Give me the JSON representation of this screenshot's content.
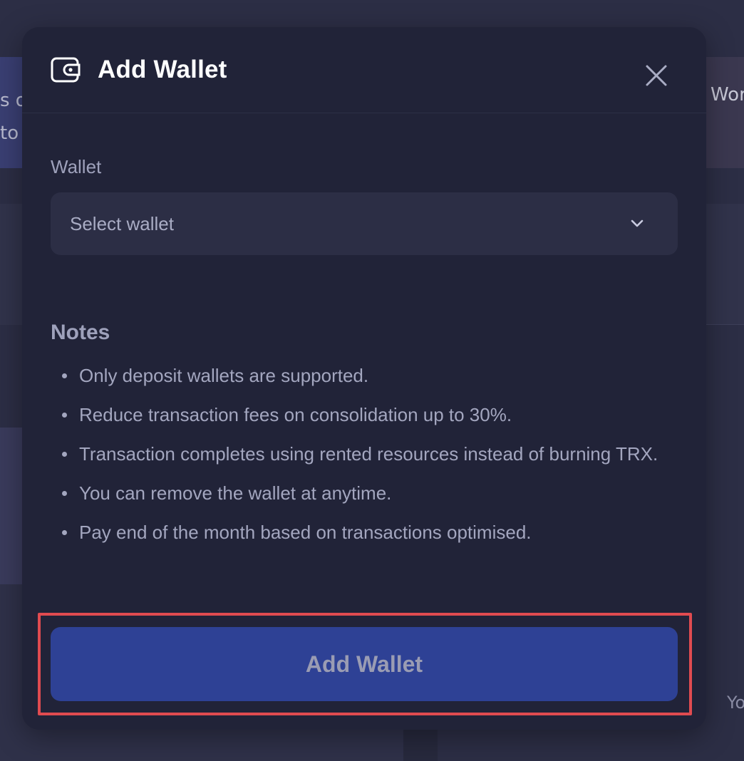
{
  "background": {
    "left_text_lines": [
      "s o",
      "to"
    ],
    "right_text": "Wor",
    "bottom_right_text": "Yo"
  },
  "modal": {
    "title": "Add Wallet",
    "header_icon": "wallet-icon",
    "close_icon": "close-icon",
    "wallet_field": {
      "label": "Wallet",
      "value": "Select wallet",
      "dropdown_icon": "chevron-down-icon"
    },
    "notes": {
      "title": "Notes",
      "items": [
        "Only deposit wallets are supported.",
        "Reduce transaction fees on consolidation up to 30%.",
        "Transaction completes using rented resources instead of burning TRX.",
        "You can remove the wallet at anytime.",
        "Pay end of the month based on transactions optimised."
      ]
    },
    "submit_label": "Add Wallet"
  },
  "colors": {
    "modal_bg": "#212338",
    "primary_button": "#2e4195",
    "highlight_border": "#e04b50"
  }
}
